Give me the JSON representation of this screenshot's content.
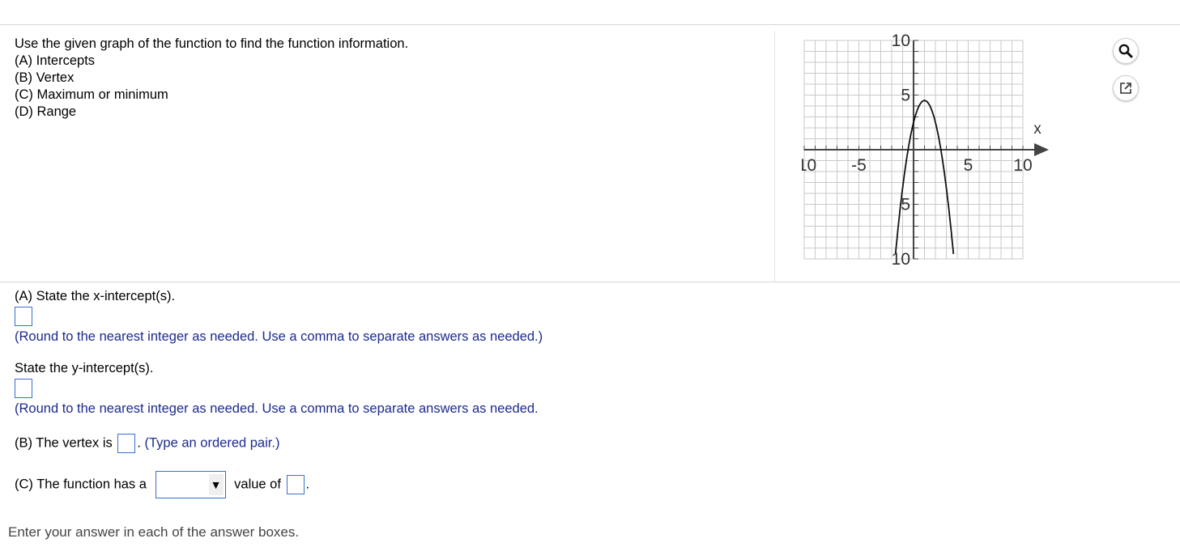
{
  "question": {
    "intro": "Use the given graph of the function to find the function information.",
    "parts": [
      "(A) Intercepts",
      "(B) Vertex",
      "(C) Maximum or minimum",
      "(D) Range"
    ]
  },
  "graph": {
    "x_axis_label": "x",
    "x_ticks": [
      "-10",
      "-5",
      "5",
      "10"
    ],
    "y_ticks": [
      "10",
      "5",
      "5",
      "10"
    ]
  },
  "chart_data": {
    "type": "line",
    "title": "",
    "xlabel": "x",
    "ylabel": "",
    "xlim": [
      -10,
      10
    ],
    "ylim": [
      -10,
      10
    ],
    "grid": true,
    "x_tick_labels": [
      "-10",
      "-5",
      "5",
      "10"
    ],
    "y_tick_labels": [
      "10",
      "5",
      "5",
      "10"
    ],
    "series": [
      {
        "x": [
          -2.0,
          -1.5,
          -1.0,
          -0.5,
          0.0,
          0.5,
          1.0,
          1.5,
          2.0,
          2.5,
          3.0,
          3.5,
          4.0,
          4.5,
          5.0
        ],
        "y": [
          -9.5,
          -5.25,
          -2.0,
          0.25,
          2.5,
          4.0,
          4.5,
          4.0,
          2.5,
          0.25,
          -2.0,
          -5.25,
          -9.5,
          -10.0,
          -10.0
        ]
      }
    ],
    "curve": {
      "vertex": [
        1,
        4.5
      ],
      "a": -2,
      "x_range": [
        -2,
        4
      ]
    }
  },
  "toolbar": {
    "zoom_icon": "magnifier-icon",
    "popout_icon": "popout-icon"
  },
  "part_a": {
    "x_prompt": "(A) State the x-intercept(s).",
    "x_hint": "(Round to the nearest integer as needed. Use a comma to separate answers as needed.)",
    "y_prompt": "State the y-intercept(s).",
    "y_hint": "(Round to the nearest integer as needed. Use a comma to separate answers as needed."
  },
  "part_b": {
    "prefix": "(B) The vertex is",
    "suffix": ".",
    "hint": "(Type an ordered pair.)"
  },
  "part_c": {
    "prefix": "(C) The function has a",
    "middle": "value of",
    "suffix": ".",
    "dropdown_value": ""
  },
  "status": "Enter your answer in each of the answer boxes."
}
